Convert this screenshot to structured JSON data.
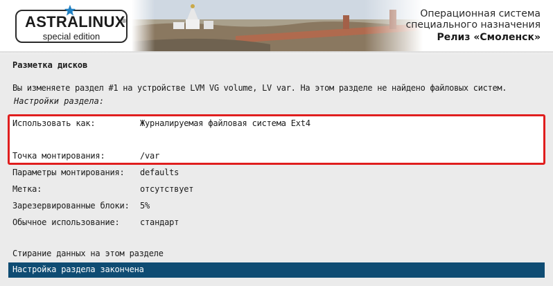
{
  "banner": {
    "logo_text": "ASTRALINUX",
    "logo_reg": "®",
    "logo_sub": "special edition",
    "title_line1": "Операционная система",
    "title_line2": "специального назначения",
    "title_line3": "Релиз «Смоленск»",
    "star_color": "#1f7fc1"
  },
  "section_title": "Разметка дисков",
  "description": "Вы изменяете раздел #1 на устройстве LVM VG volume, LV var. На этом разделе не найдено файловых систем.",
  "subheading": "Настройки раздела:",
  "settings": [
    {
      "key": "Использовать как:",
      "value": "Журналируемая файловая система Ext4"
    },
    {
      "key": "Точка монтирования:",
      "value": "/var"
    },
    {
      "key": "Параметры монтирования:",
      "value": "defaults"
    },
    {
      "key": "Метка:",
      "value": "отсутствует"
    },
    {
      "key": "Зарезервированные блоки:",
      "value": "5%"
    },
    {
      "key": "Обычное использование:",
      "value": "стандарт"
    }
  ],
  "actions": [
    {
      "label": "Стирание данных на этом разделе"
    },
    {
      "label": "Настройка раздела закончена",
      "selected": true
    }
  ],
  "colors": {
    "highlight_border": "#e01e1e",
    "selected_bg": "#0f4c73",
    "content_bg": "#ebebeb"
  }
}
